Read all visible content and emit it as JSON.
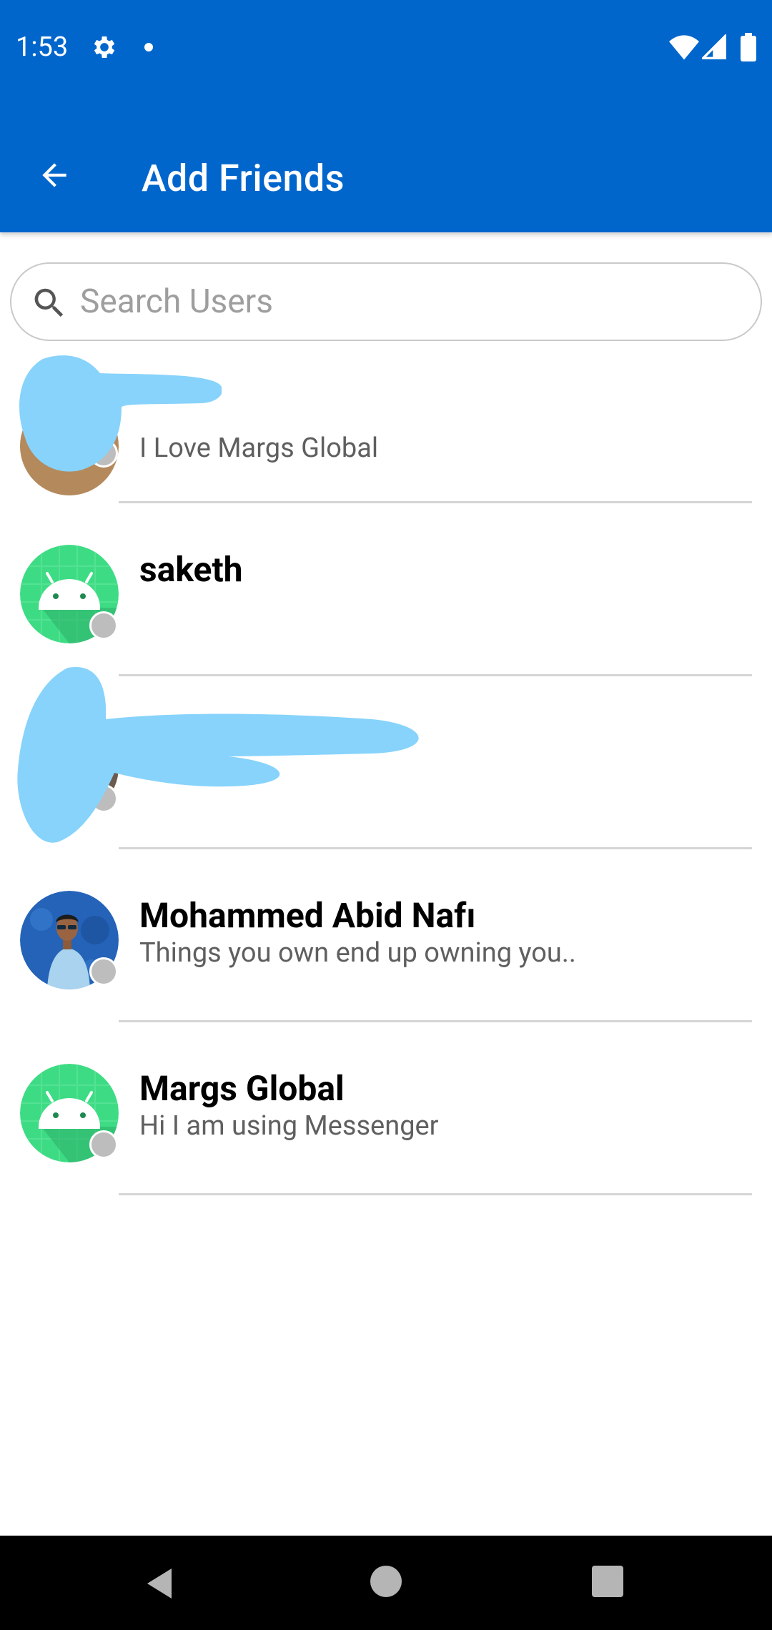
{
  "status_bar": {
    "time": "1:53",
    "icons": [
      "gear-icon",
      "notification-dot-icon",
      "wifi-icon",
      "signal-icon",
      "battery-icon"
    ]
  },
  "app_bar": {
    "title": "Add Friends",
    "back_icon": "arrow-left-icon"
  },
  "search": {
    "placeholder": "Search Users",
    "value": "",
    "icon": "search-icon"
  },
  "users": [
    {
      "name": "",
      "status": "I Love Margs Global",
      "avatar": "redacted",
      "online": false
    },
    {
      "name": "saketh",
      "status": "",
      "avatar": "android-default",
      "online": false
    },
    {
      "name": "",
      "status": "",
      "avatar": "redacted",
      "online": false
    },
    {
      "name": "Mohammed Abid Nafı",
      "status": "Things you own end up owning you..",
      "avatar": "photo",
      "online": false
    },
    {
      "name": "Margs Global",
      "status": "Hi I am using Messenger",
      "avatar": "android-default",
      "online": false
    }
  ],
  "colors": {
    "primary": "#0066cc",
    "presence_offline": "#bdbdbd",
    "redaction": "#87d3fb",
    "android_avatar": "#3ddc84"
  },
  "nav_bar": {
    "buttons": [
      "back-triangle-icon",
      "home-circle-icon",
      "recents-square-icon"
    ]
  }
}
